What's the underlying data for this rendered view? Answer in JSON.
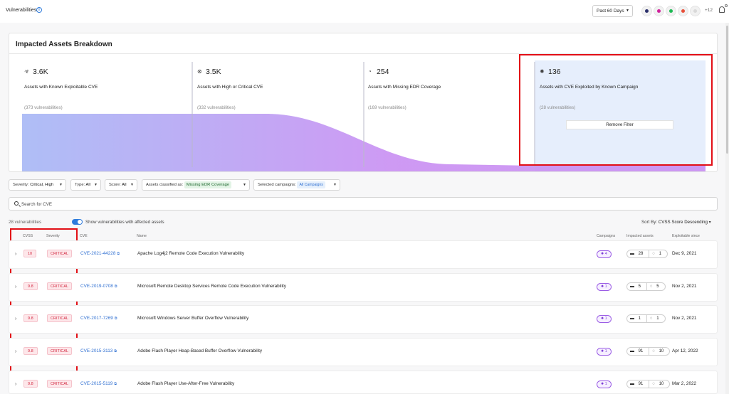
{
  "topbar": {
    "title": "Vulnerabilities",
    "info_icon": "info-icon",
    "period": "Past 60 Days",
    "tools": [
      {
        "icon": "pen-icon",
        "color": "#2b2f6b"
      },
      {
        "icon": "target-icon",
        "color": "#d0219b"
      },
      {
        "icon": "leaf-icon",
        "color": "#1db954"
      },
      {
        "icon": "flame-icon",
        "color": "#e8503a"
      },
      {
        "icon": "shield-icon",
        "color": "#d9d9d9"
      }
    ],
    "more_count": "+12",
    "bell_icon": "bell-icon"
  },
  "breakdown": {
    "title": "Impacted Assets Breakdown",
    "stats": [
      {
        "icon": "bug-icon",
        "glyph": "☣",
        "value": "3.6K",
        "label": "Assets with Known Exploitable CVE",
        "sub": "(373 vulnerabilities)"
      },
      {
        "icon": "link-icon",
        "glyph": "⊗",
        "value": "3.5K",
        "label": "Assets with High or Critical CVE",
        "sub": "(332 vulnerabilities)"
      },
      {
        "icon": "radar-icon",
        "glyph": "◔",
        "value": "254",
        "label": "Assets with Missing EDR Coverage",
        "sub": "(169 vulnerabilities)"
      },
      {
        "icon": "virus-icon",
        "glyph": "✹",
        "value": "136",
        "label": "Assets with CVE Exploited by Known Campaign",
        "sub": "(28 vulnerabilities)"
      }
    ],
    "remove_filter": "Remove Filter",
    "funnel_levels": [
      3600,
      3500,
      254,
      136
    ],
    "colors": {
      "start": "#a6b7f5",
      "mid": "#c98ef2",
      "selected_bg": "#e6eefc"
    }
  },
  "filters": {
    "severity_label": "Severity:",
    "severity_value": "Critical, High",
    "type_label": "Type:",
    "type_value": "All",
    "score_label": "Score:",
    "score_value": "All",
    "classified_label": "Assets classified as:",
    "classified_value": "Missing EDR Coverage",
    "campaigns_label": "Selected campaigns:",
    "campaigns_value": "All Campaigns"
  },
  "search": {
    "placeholder": "Search for CVE"
  },
  "list": {
    "count": "28 vulnerabilities",
    "toggle_label": "Show vulnerabilities with affected assets",
    "sort_label": "Sort By:",
    "sort_value": "CVSS Score Descending",
    "columns": {
      "cvss": "CVSS",
      "severity": "Severity",
      "cve": "CVE",
      "name": "Name",
      "campaigns": "Campaigns",
      "impacted": "Impacted assets",
      "exploitable": "Exploitable since"
    },
    "rows": [
      {
        "cvss": "10",
        "severity": "CRITICAL",
        "cve": "CVE-2021-44228",
        "name": "Apache Log4j2 Remote Code Execution Vulnerability",
        "campaigns": "4",
        "assets_a": "28",
        "assets_b": "1",
        "date": "Dec 9, 2021"
      },
      {
        "cvss": "9.8",
        "severity": "CRITICAL",
        "cve": "CVE-2019-0708",
        "name": "Microsoft Remote Desktop Services Remote Code Execution Vulnerability",
        "campaigns": "1",
        "assets_a": "5",
        "assets_b": "5",
        "date": "Nov 2, 2021"
      },
      {
        "cvss": "9.8",
        "severity": "CRITICAL",
        "cve": "CVE-2017-7269",
        "name": "Microsoft Windows Server Buffer Overflow Vulnerability",
        "campaigns": "1",
        "assets_a": "1",
        "assets_b": "1",
        "date": "Nov 2, 2021"
      },
      {
        "cvss": "9.8",
        "severity": "CRITICAL",
        "cve": "CVE-2015-3113",
        "name": "Adobe Flash Player Heap-Based Buffer Overflow Vulnerability",
        "campaigns": "1",
        "assets_a": "91",
        "assets_b": "10",
        "date": "Apr 12, 2022"
      },
      {
        "cvss": "9.8",
        "severity": "CRITICAL",
        "cve": "CVE-2015-5119",
        "name": "Adobe Flash Player Use-After-Free Vulnerability",
        "campaigns": "1",
        "assets_a": "91",
        "assets_b": "10",
        "date": "Mar 2, 2022"
      }
    ]
  },
  "highlight_color": "#e20f16"
}
